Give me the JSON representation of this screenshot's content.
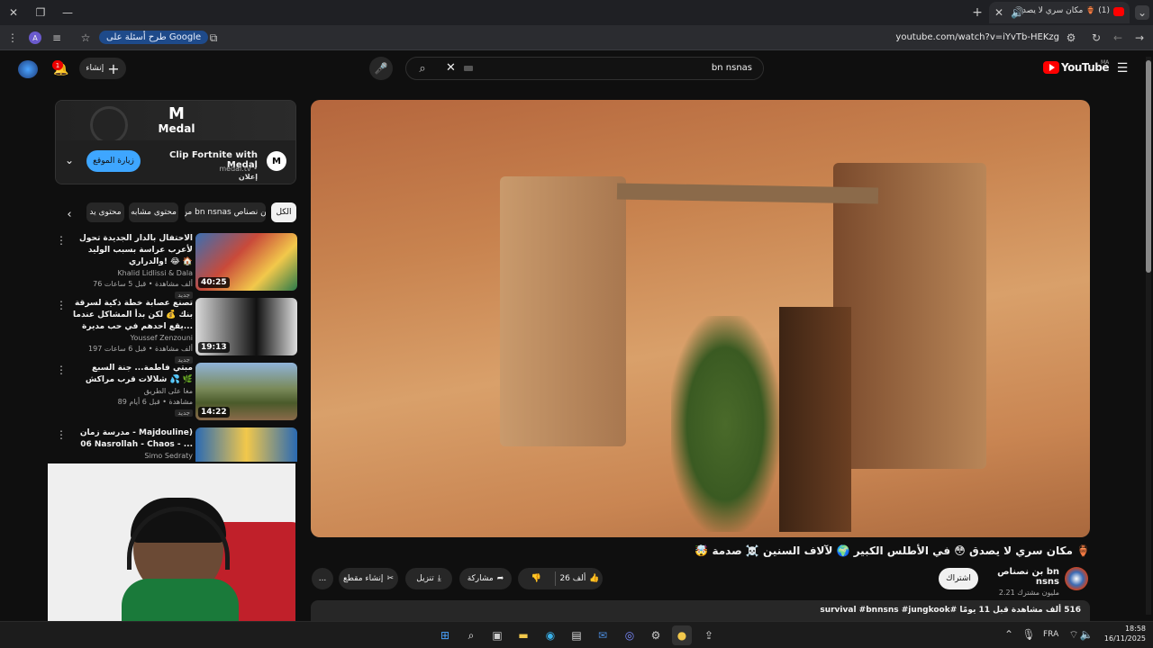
{
  "browser": {
    "tab_title": "(1) 🏺 مكان سري لا يصدق 😳",
    "url": "youtube.com/watch?v=iYvTb-HEKzg",
    "google_pill": "طرح أسئلة على Google",
    "profile_initial": "A"
  },
  "youtube": {
    "logo_text": "YouTube",
    "region": "MA",
    "search_value": "bn nsnas",
    "create_label": "إنشاء",
    "notif_count": "1"
  },
  "ad": {
    "brand": "Medal",
    "title": "Clip Fortnite with Medal",
    "sponsor": "إعلان",
    "domain": "medal.tv",
    "visit_label": "زيارة الموقع"
  },
  "chips": [
    "الكل",
    "من bn nsnas بن نصناص",
    "محتوى مشابه",
    "محتوى يد"
  ],
  "recommendations": [
    {
      "title": "الاحتفال بالدار الجديدة تحول لأعرب عراسة بسبب الوليد والدراري! 😂 🏠",
      "channel": "Khalid Lidlissi & Dala",
      "meta": "76 ألف مشاهدة • قبل 5 ساعات",
      "badge": "جديد",
      "duration": "40:25"
    },
    {
      "title": "تصنع عصابة خطة ذكية لسرقة بنك 💰 لكن بدأ المشاكل عندما يقع احدهم في حب مديرة...",
      "channel": "Youssef Zenzouni",
      "meta": "197 ألف مشاهدة • قبل 6 ساعات",
      "badge": "جديد",
      "duration": "19:13"
    },
    {
      "title": "مبتي فاطمة... جنة السبع شلالات قرب مراكش 💦 🌿",
      "channel": "مغا على الطريق",
      "meta": "89 مشاهدة • قبل 6 أيام",
      "badge": "جديد",
      "duration": "14:22"
    },
    {
      "title": "مدرسة زمان - Majdouline) 06 Nasrollah - Chaos - ...",
      "channel": "Simo Sedraty",
      "meta": "",
      "badge": "",
      "duration": ""
    }
  ],
  "video": {
    "title": "🏺 مكان سري لا يصدق 😳 في الأطلس الكبير 🌍 لآلاف السنين ☠️ صدمة 🤯",
    "channel_name": "بن نصناص bn nsns",
    "subscribers": "2.21 مليون مشترك",
    "subscribe_label": "اشتراك",
    "likes": "26 ألف",
    "share_label": "مشاركة",
    "download_label": "تنزيل",
    "clip_label": "إنشاء مقطع",
    "more_label": "...",
    "description": "516 ألف مشاهدة قبل 11 يومًا  #survival #bnnsns #jungkook"
  },
  "taskbar": {
    "lang": "FRA",
    "time": "18:58",
    "date": "16/11/2025"
  },
  "colors": {
    "accent": "#3ea6ff",
    "youtube_red": "#ff0000",
    "bg": "#0f0f0f"
  }
}
